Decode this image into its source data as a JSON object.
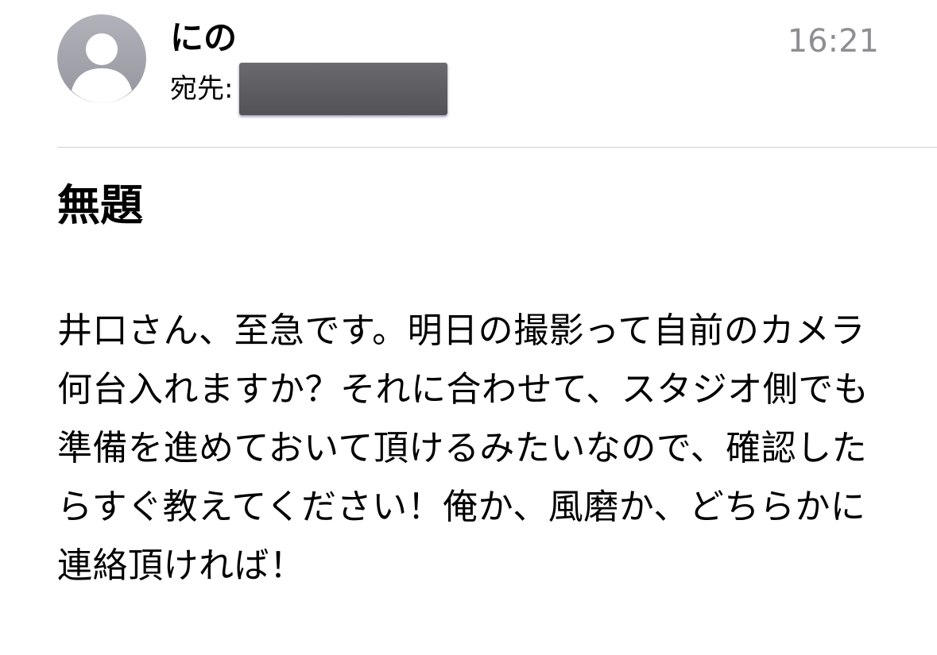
{
  "header": {
    "avatar_icon": "person-silhouette-icon",
    "sender_name": "にの",
    "recipient_label": "宛先:",
    "time": "16:21"
  },
  "subject": "無題",
  "body": "井口さん、至急です。明日の撮影って自前のカメラ何台入れますか？それに合わせて、スタジオ側でも準備を進めておいて頂けるみたいなので、確認したらすぐ教えてください！俺か、風磨か、どちらかに連絡頂ければ！",
  "colors": {
    "avatar_bg": "#a3a4ab",
    "avatar_figure": "#ffffff",
    "timestamp": "#8e8e93",
    "divider": "#d1d1d6",
    "redaction": "#5c5c60"
  }
}
